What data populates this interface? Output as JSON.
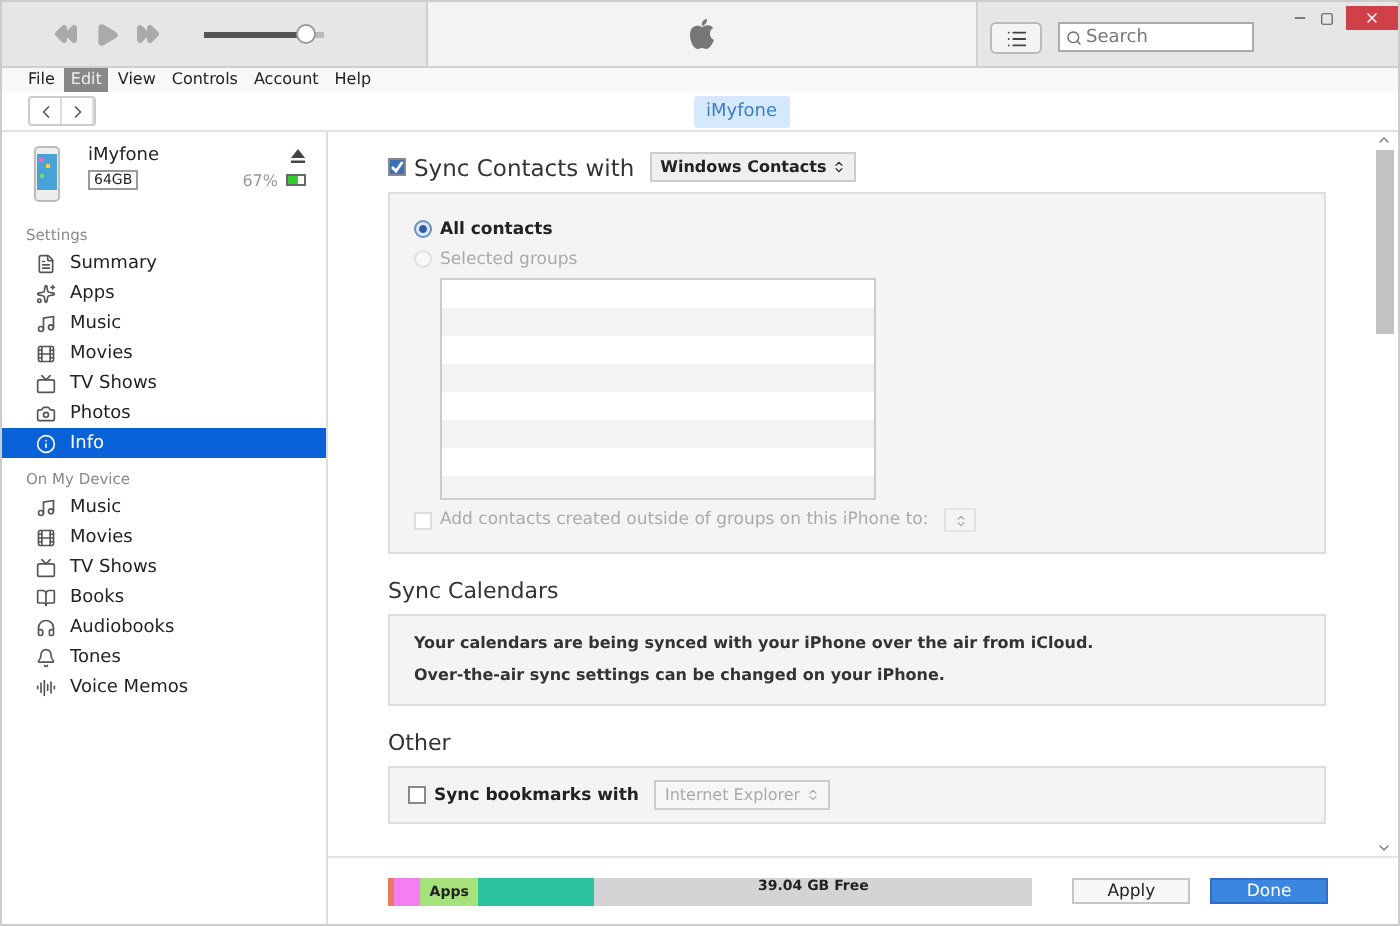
{
  "toolbar": {
    "volume": {
      "level": 0.85
    },
    "search": {
      "placeholder": "Search"
    }
  },
  "menu": [
    {
      "label": "File",
      "selected": false
    },
    {
      "label": "Edit",
      "selected": true
    },
    {
      "label": "View",
      "selected": false
    },
    {
      "label": "Controls",
      "selected": false
    },
    {
      "label": "Account",
      "selected": false
    },
    {
      "label": "Help",
      "selected": false
    }
  ],
  "device_tab": "iMyfone",
  "device": {
    "name": "iMyfone",
    "capacity": "64GB",
    "battery": "67%",
    "battery_meter": {
      "level": 0.67
    }
  },
  "sidebar": [
    {
      "heading": "Settings",
      "items": [
        {
          "label": "Summary",
          "kind": "summary",
          "selected": false
        },
        {
          "label": "Apps",
          "kind": "apps",
          "selected": false
        },
        {
          "label": "Music",
          "kind": "music",
          "selected": false
        },
        {
          "label": "Movies",
          "kind": "movies",
          "selected": false
        },
        {
          "label": "TV Shows",
          "kind": "tv",
          "selected": false
        },
        {
          "label": "Photos",
          "kind": "photos",
          "selected": false
        },
        {
          "label": "Info",
          "kind": "info",
          "selected": true
        }
      ]
    },
    {
      "heading": "On My Device",
      "items": [
        {
          "label": "Music",
          "kind": "music",
          "selected": false
        },
        {
          "label": "Movies",
          "kind": "movies",
          "selected": false
        },
        {
          "label": "TV Shows",
          "kind": "tv",
          "selected": false
        },
        {
          "label": "Books",
          "kind": "books",
          "selected": false
        },
        {
          "label": "Audiobooks",
          "kind": "audiobooks",
          "selected": false
        },
        {
          "label": "Tones",
          "kind": "tones",
          "selected": false
        },
        {
          "label": "Voice Memos",
          "kind": "memos",
          "selected": false
        }
      ]
    }
  ],
  "contacts": {
    "label": "Sync Contacts with",
    "checked": true,
    "source": "Windows Contacts",
    "options": [
      {
        "label": "All contacts",
        "selected": true,
        "disabled": false
      },
      {
        "label": "Selected groups",
        "selected": false,
        "disabled": true
      }
    ],
    "add_outside": {
      "label": "Add contacts created outside of groups on this iPhone to:",
      "checked": false,
      "disabled": true
    }
  },
  "calendars": {
    "title": "Sync Calendars",
    "lines": [
      "Your calendars are being synced with your iPhone over the air from iCloud.",
      "Over-the-air sync settings can be changed on your iPhone."
    ]
  },
  "other": {
    "title": "Other",
    "bookmarks": {
      "label": "Sync bookmarks with",
      "checked": false,
      "browser": "Internet Explorer"
    }
  },
  "storage": {
    "segments": [
      {
        "color": "#f07860",
        "level": 0.01
      },
      {
        "color": "#f57ef0",
        "level": 0.04
      },
      {
        "color": "#a6e27c",
        "level": 0.09,
        "label": "Apps"
      },
      {
        "color": "#29c29c",
        "level": 0.18
      }
    ],
    "free": "39.04 GB Free"
  },
  "buttons": [
    {
      "label": "Apply",
      "kind": "secondary"
    },
    {
      "label": "Done",
      "kind": "primary"
    }
  ]
}
